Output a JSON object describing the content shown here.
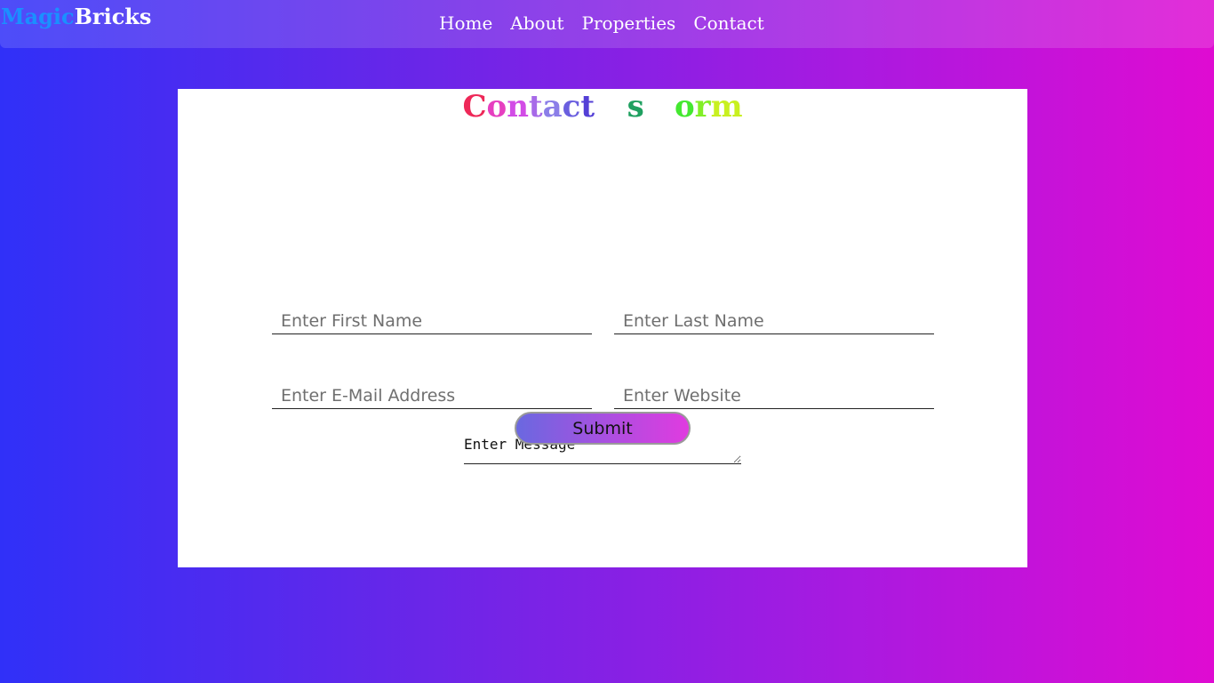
{
  "brand": {
    "part1": "Magic",
    "part2": "Bricks",
    "part1_color": "#1a90ff",
    "part2_color": "#ffffff"
  },
  "nav": {
    "items": [
      {
        "label": "Home"
      },
      {
        "label": "About"
      },
      {
        "label": "Properties"
      },
      {
        "label": "Contact"
      }
    ]
  },
  "form": {
    "title": "Contact us Form",
    "title_colors": [
      "#ee2858",
      "#e63fc0",
      "#d24ce6",
      "#a76ae8",
      "#8b7ee8",
      "#6a5fdf",
      "#5440d6",
      "#3a2fc0",
      "#ffffff",
      "#1fa060",
      "#2ccf4a",
      "#ffffff",
      "#44e830",
      "#82ef27",
      "#c8f020",
      "#f0e21a",
      "#f59a1a"
    ],
    "first_name_placeholder": "Enter First Name",
    "last_name_placeholder": "Enter Last Name",
    "email_placeholder": "Enter E-Mail Address",
    "website_placeholder": "Enter Website",
    "message_placeholder": "Enter Message",
    "submit_label": "Submit"
  },
  "colors": {
    "bg_left": "#3030f8",
    "bg_right": "#df0bd2"
  }
}
